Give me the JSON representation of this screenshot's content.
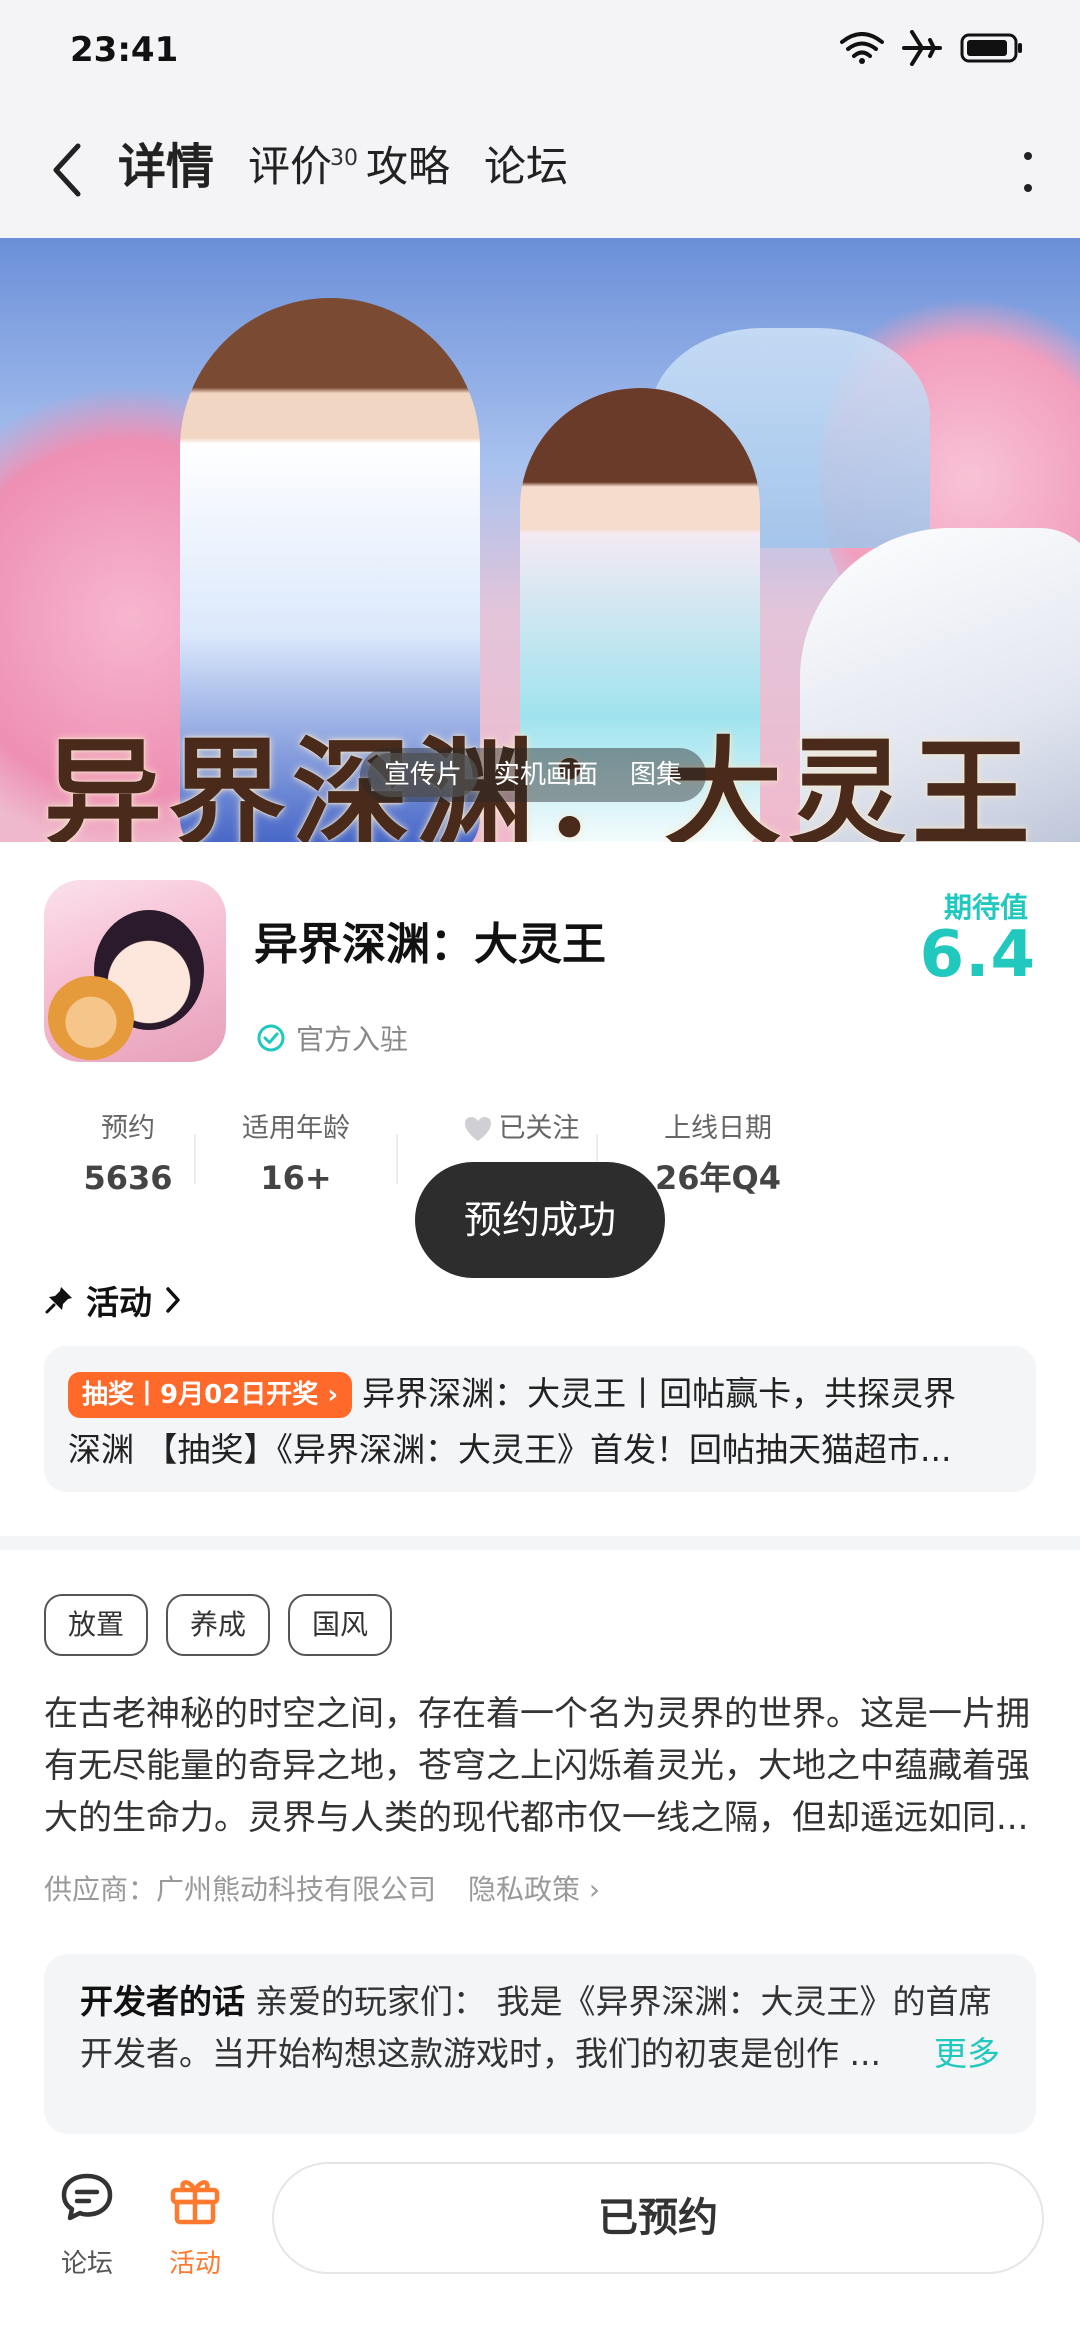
{
  "status_bar": {
    "time": "23:41"
  },
  "nav": {
    "tabs": [
      {
        "label": "详情",
        "active": true
      },
      {
        "label": "评价",
        "badge": "30"
      },
      {
        "label": "攻略"
      },
      {
        "label": "论坛"
      }
    ]
  },
  "banner": {
    "art_title": "异界深渊：大灵王",
    "media_tabs": [
      {
        "label": "宣传片",
        "active": true
      },
      {
        "label": "实机画面"
      },
      {
        "label": "图集"
      }
    ]
  },
  "app": {
    "name": "异界深渊：大灵王",
    "official": "官方入驻",
    "expectation_label": "期待值",
    "expectation_value": "6.4"
  },
  "stats": [
    {
      "label": "预约",
      "value": "5636"
    },
    {
      "label": "适用年龄",
      "value": "16+"
    },
    {
      "label": "已关注",
      "value": ""
    },
    {
      "label": "上线日期",
      "value": "26年Q4"
    }
  ],
  "toast": "预约成功",
  "activity": {
    "heading": "活动",
    "badge": "抽奖丨9月02日开奖",
    "line1": "异界深渊：大灵王丨回帖赢卡，共探灵界",
    "line2": "深渊 【抽奖】《异界深渊：大灵王》首发！回帖抽天猫超市..."
  },
  "tags": [
    "放置",
    "养成",
    "国风"
  ],
  "description": "在古老神秘的时空之间，存在着一个名为灵界的世界。这是一片拥有无尽能量的奇异之地，苍穹之上闪烁着灵光，大地之中蕴藏着强大的生命力。灵界与人类的现代都市仅一线之隔，但却遥远如同...",
  "supplier": {
    "label": "供应商：广州熊动科技有限公司",
    "privacy": "隐私政策"
  },
  "developer": {
    "title": "开发者的话",
    "text": "亲爱的玩家们： 我是《异界深渊：大灵王》的首席开发者。当开始构想这款游戏时，我们的初衷是创作 ...",
    "more": "更多"
  },
  "bottom_bar": {
    "forum": "论坛",
    "activity": "活动",
    "reserve": "已预约"
  },
  "colors": {
    "accent": "#21c8bd",
    "badge_orange": "#ff6a2b",
    "activity_tab": "#ff7a2e"
  }
}
